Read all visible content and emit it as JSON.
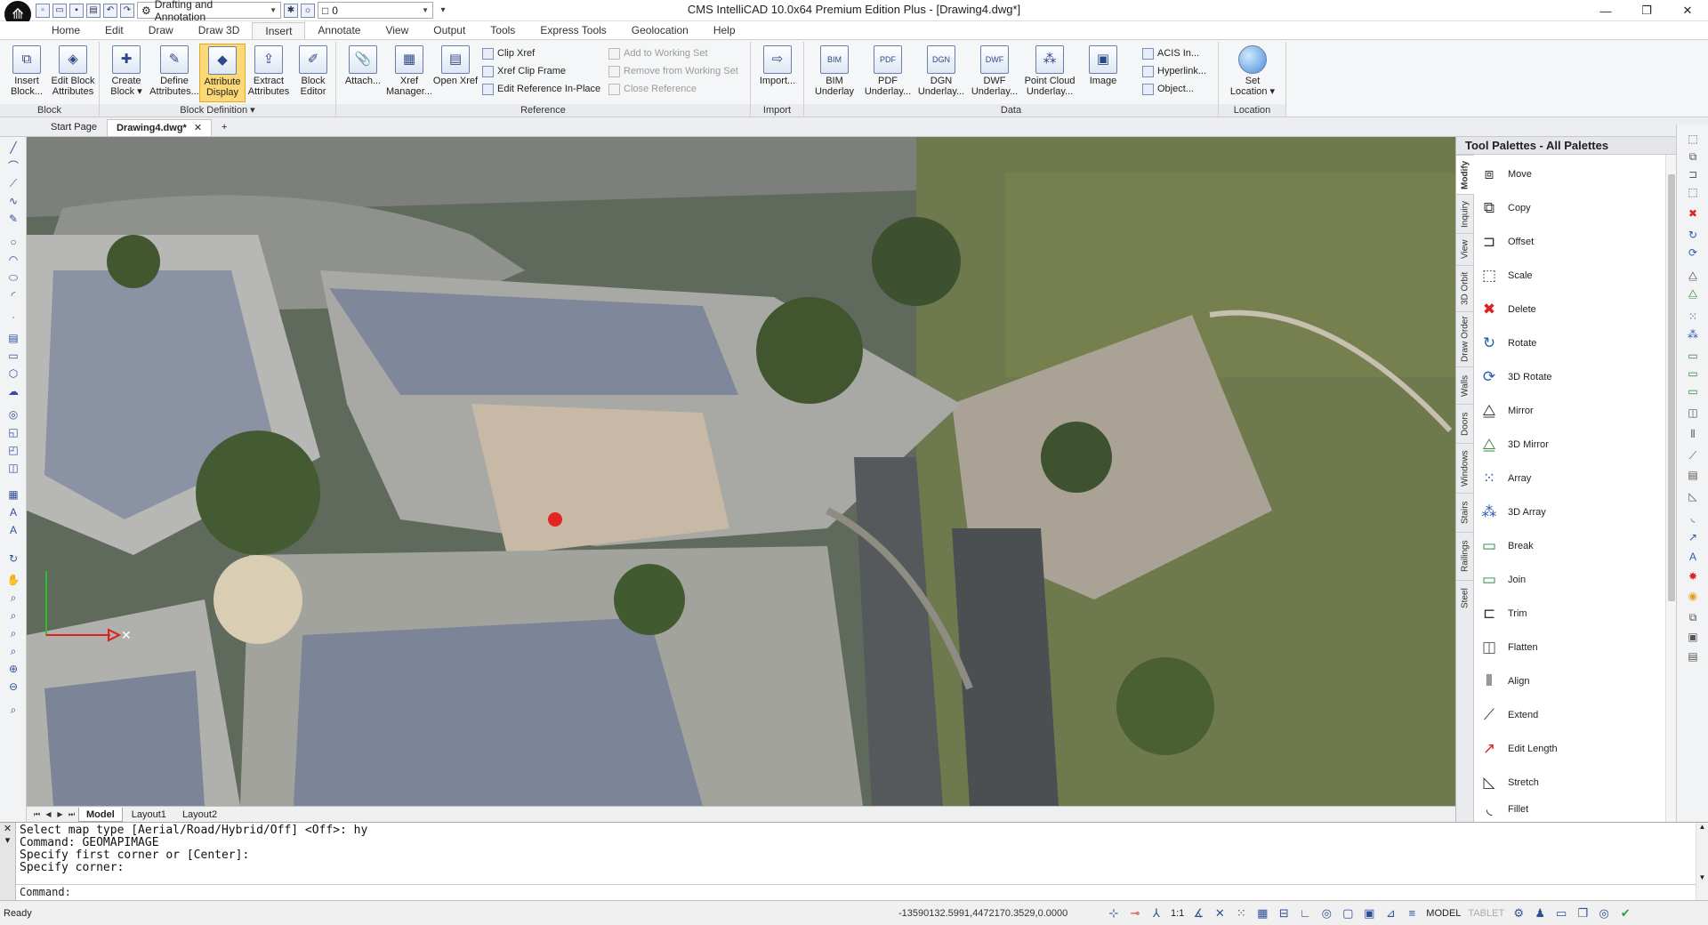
{
  "window": {
    "title": "CMS IntelliCAD 10.0x64 Premium Edition Plus - [Drawing4.dwg*]"
  },
  "quick_access": {
    "workspace": "Drafting and Annotation",
    "layer": "0"
  },
  "ribbon_tabs": [
    "Home",
    "Edit",
    "Draw",
    "Draw 3D",
    "Insert",
    "Annotate",
    "View",
    "Output",
    "Tools",
    "Express Tools",
    "Geolocation",
    "Help"
  ],
  "ribbon": {
    "block": {
      "label": "Block",
      "insert": "Insert Block...",
      "edit_attr": "Edit Block Attributes"
    },
    "block_def": {
      "label": "Block Definition ▾",
      "create": "Create Block ▾",
      "define": "Define Attributes...",
      "attr_display": "Attribute Display",
      "extract": "Extract Attributes",
      "editor": "Block Editor"
    },
    "reference": {
      "label": "Reference",
      "attach": "Attach...",
      "xref_manager": "Xref Manager...",
      "open_xref": "Open Xref",
      "clip_xref": "Clip Xref",
      "xref_clip_frame": "Xref Clip Frame",
      "edit_ref": "Edit Reference In-Place",
      "add_ws": "Add to Working Set",
      "remove_ws": "Remove from Working Set",
      "close_ref": "Close Reference"
    },
    "import": {
      "label": "Import",
      "import": "Import..."
    },
    "data": {
      "label": "Data",
      "bim": "BIM Underlay",
      "pdf": "PDF Underlay...",
      "dgn": "DGN Underlay...",
      "dwf": "DWF Underlay...",
      "pointcloud": "Point Cloud Underlay...",
      "image": "Image",
      "acis": "ACIS In...",
      "hyperlink": "Hyperlink...",
      "object": "Object..."
    },
    "location": {
      "label": "Location",
      "set": "Set Location ▾"
    }
  },
  "doc_tabs": {
    "start": "Start Page",
    "drawing": "Drawing4.dwg*",
    "close": "✕",
    "add": "+"
  },
  "layout_tabs": [
    "Model",
    "Layout1",
    "Layout2"
  ],
  "palette": {
    "title": "Tool Palettes - All Palettes",
    "tabs": [
      "Modify",
      "Inquiry",
      "View",
      "3D Orbit",
      "Draw Order",
      "Walls",
      "Doors",
      "Windows",
      "Stairs",
      "Railings",
      "Steel"
    ],
    "items": [
      "Move",
      "Copy",
      "Offset",
      "Scale",
      "Delete",
      "Rotate",
      "3D Rotate",
      "Mirror",
      "3D Mirror",
      "Array",
      "3D Array",
      "Break",
      "Join",
      "Trim",
      "Flatten",
      "Align",
      "Extend",
      "Edit Length",
      "Stretch",
      "Fillet"
    ]
  },
  "command": {
    "lines": [
      "Select map type [Aerial/Road/Hybrid/Off] <Off>: hy",
      "Command: GEOMAPIMAGE",
      "Specify first corner or [Center]:",
      "Specify corner:"
    ],
    "prompt": "Command:"
  },
  "status": {
    "ready": "Ready",
    "coords": "-13590132.5991,4472170.3529,0.0000",
    "scale": "1:1",
    "model": "MODEL",
    "tablet": "TABLET"
  },
  "colors": {
    "accent": "#fbd976",
    "ribbon_bg": "#f5f6f7"
  }
}
